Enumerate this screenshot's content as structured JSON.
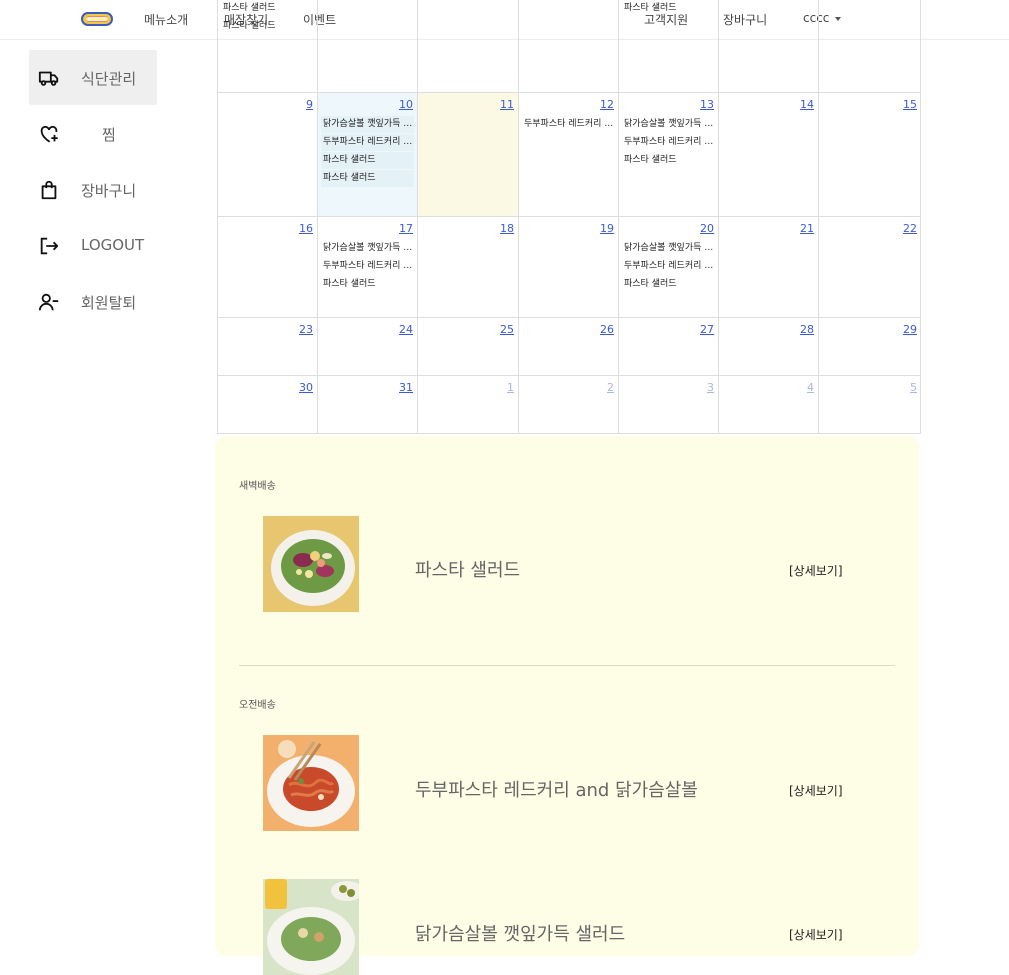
{
  "header": {
    "menu": [
      "메뉴소개",
      "매장찾기",
      "이벤트"
    ],
    "right": [
      "고객지원",
      "장바구니"
    ],
    "user": "cccc"
  },
  "sidebar": [
    {
      "label": "식단관리",
      "icon": "truck-icon",
      "active": true
    },
    {
      "label": "찜",
      "icon": "heart-plus-icon"
    },
    {
      "label": "장바구니",
      "icon": "shopping-bag-icon"
    },
    {
      "label": "LOGOUT",
      "icon": "logout-icon"
    },
    {
      "label": "회원탈퇴",
      "icon": "user-minus-icon"
    }
  ],
  "calendar": {
    "previous_row_events": [
      [
        "파스타 샐러드",
        "파스타 샐러드"
      ],
      [],
      [],
      [],
      [
        "파스타 샐러드"
      ],
      [],
      []
    ],
    "weeks": [
      [
        {
          "day": "9",
          "events": []
        },
        {
          "day": "10",
          "events": [
            "닭가슴살볼 깻잎가득 샐러드",
            "두부파스타 레드커리 and 닭가슴살볼",
            "파스타 샐러드",
            "파스타 샐러드"
          ],
          "selected": true
        },
        {
          "day": "11",
          "events": [],
          "today": true
        },
        {
          "day": "12",
          "events": [
            "두부파스타 레드커리 and 닭가슴살볼"
          ]
        },
        {
          "day": "13",
          "events": [
            "닭가슴살볼 깻잎가득 샐러드",
            "두부파스타 레드커리 and 닭가슴살볼",
            "파스타 샐러드"
          ]
        },
        {
          "day": "14",
          "events": []
        },
        {
          "day": "15",
          "events": []
        }
      ],
      [
        {
          "day": "16",
          "events": []
        },
        {
          "day": "17",
          "events": [
            "닭가슴살볼 깻잎가득 샐러드",
            "두부파스타 레드커리 and 닭가슴살볼",
            "파스타 샐러드"
          ]
        },
        {
          "day": "18",
          "events": []
        },
        {
          "day": "19",
          "events": []
        },
        {
          "day": "20",
          "events": [
            "닭가슴살볼 깻잎가득 샐러드",
            "두부파스타 레드커리 and 닭가슴살볼",
            "파스타 샐러드"
          ]
        },
        {
          "day": "21",
          "events": []
        },
        {
          "day": "22",
          "events": []
        }
      ],
      [
        {
          "day": "23",
          "events": []
        },
        {
          "day": "24",
          "events": []
        },
        {
          "day": "25",
          "events": []
        },
        {
          "day": "26",
          "events": []
        },
        {
          "day": "27",
          "events": []
        },
        {
          "day": "28",
          "events": []
        },
        {
          "day": "29",
          "events": []
        }
      ],
      [
        {
          "day": "30",
          "events": []
        },
        {
          "day": "31",
          "events": []
        },
        {
          "day": "1",
          "events": [],
          "other": true
        },
        {
          "day": "2",
          "events": [],
          "other": true
        },
        {
          "day": "3",
          "events": [],
          "other": true
        },
        {
          "day": "4",
          "events": [],
          "other": true
        },
        {
          "day": "5",
          "events": [],
          "other": true
        }
      ]
    ]
  },
  "delivery": [
    {
      "section": "새벽배송",
      "name": "파스타 샐러드",
      "detail": "[상세보기]",
      "image": "pasta-salad"
    },
    {
      "section": "오전배송",
      "name": "두부파스타 레드커리 and 닭가슴살볼",
      "detail": "[상세보기]",
      "image": "red-curry-pasta"
    },
    {
      "section": "",
      "name": "닭가슴살볼 깻잎가득 샐러드",
      "detail": "[상세보기]",
      "image": "salad-bowl"
    }
  ],
  "colors": {
    "accent": "#3b5bd6",
    "panel": "#fefde6",
    "today": "#fbf9e4",
    "selected": "#eef7fb"
  }
}
